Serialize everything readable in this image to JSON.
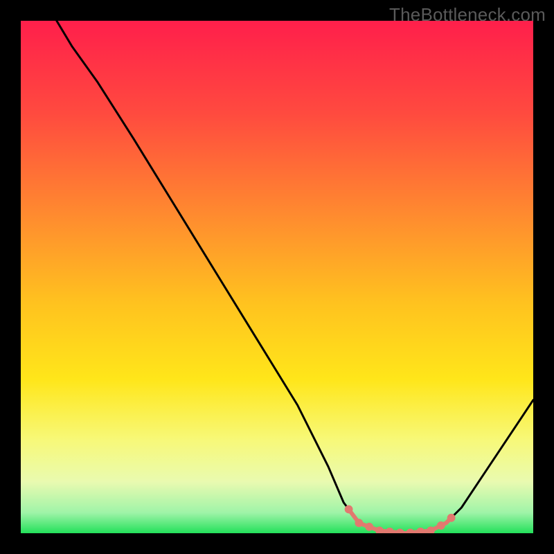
{
  "watermark": "TheBottleneck.com",
  "chart_data": {
    "type": "line",
    "title": "",
    "xlabel": "",
    "ylabel": "",
    "xlim": [
      0,
      100
    ],
    "ylim": [
      0,
      100
    ],
    "grid": false,
    "legend": false,
    "gradient_stops": [
      {
        "offset": 0,
        "color": "#ff1f4b"
      },
      {
        "offset": 18,
        "color": "#ff4a3f"
      },
      {
        "offset": 38,
        "color": "#ff8b2f"
      },
      {
        "offset": 55,
        "color": "#ffc21f"
      },
      {
        "offset": 70,
        "color": "#ffe61a"
      },
      {
        "offset": 82,
        "color": "#f7f97a"
      },
      {
        "offset": 90,
        "color": "#e9fab0"
      },
      {
        "offset": 96,
        "color": "#9ff4a8"
      },
      {
        "offset": 100,
        "color": "#23e05a"
      }
    ],
    "curve": [
      {
        "x": 7,
        "y": 100
      },
      {
        "x": 10,
        "y": 95
      },
      {
        "x": 15,
        "y": 88
      },
      {
        "x": 22,
        "y": 77
      },
      {
        "x": 30,
        "y": 64
      },
      {
        "x": 38,
        "y": 51
      },
      {
        "x": 46,
        "y": 38
      },
      {
        "x": 54,
        "y": 25
      },
      {
        "x": 60,
        "y": 13
      },
      {
        "x": 63,
        "y": 6
      },
      {
        "x": 66,
        "y": 2
      },
      {
        "x": 70,
        "y": 0.5
      },
      {
        "x": 75,
        "y": 0
      },
      {
        "x": 80,
        "y": 0.5
      },
      {
        "x": 83,
        "y": 2
      },
      {
        "x": 86,
        "y": 5
      },
      {
        "x": 90,
        "y": 11
      },
      {
        "x": 94,
        "y": 17
      },
      {
        "x": 98,
        "y": 23
      },
      {
        "x": 100,
        "y": 26
      }
    ],
    "marker_region": {
      "x_start": 64,
      "x_end": 84,
      "y_near": 0,
      "color": "#e2796f",
      "point_radius": 0.8,
      "points_x": [
        64,
        66,
        68,
        70,
        72,
        74,
        76,
        78,
        80,
        82,
        84
      ]
    }
  }
}
